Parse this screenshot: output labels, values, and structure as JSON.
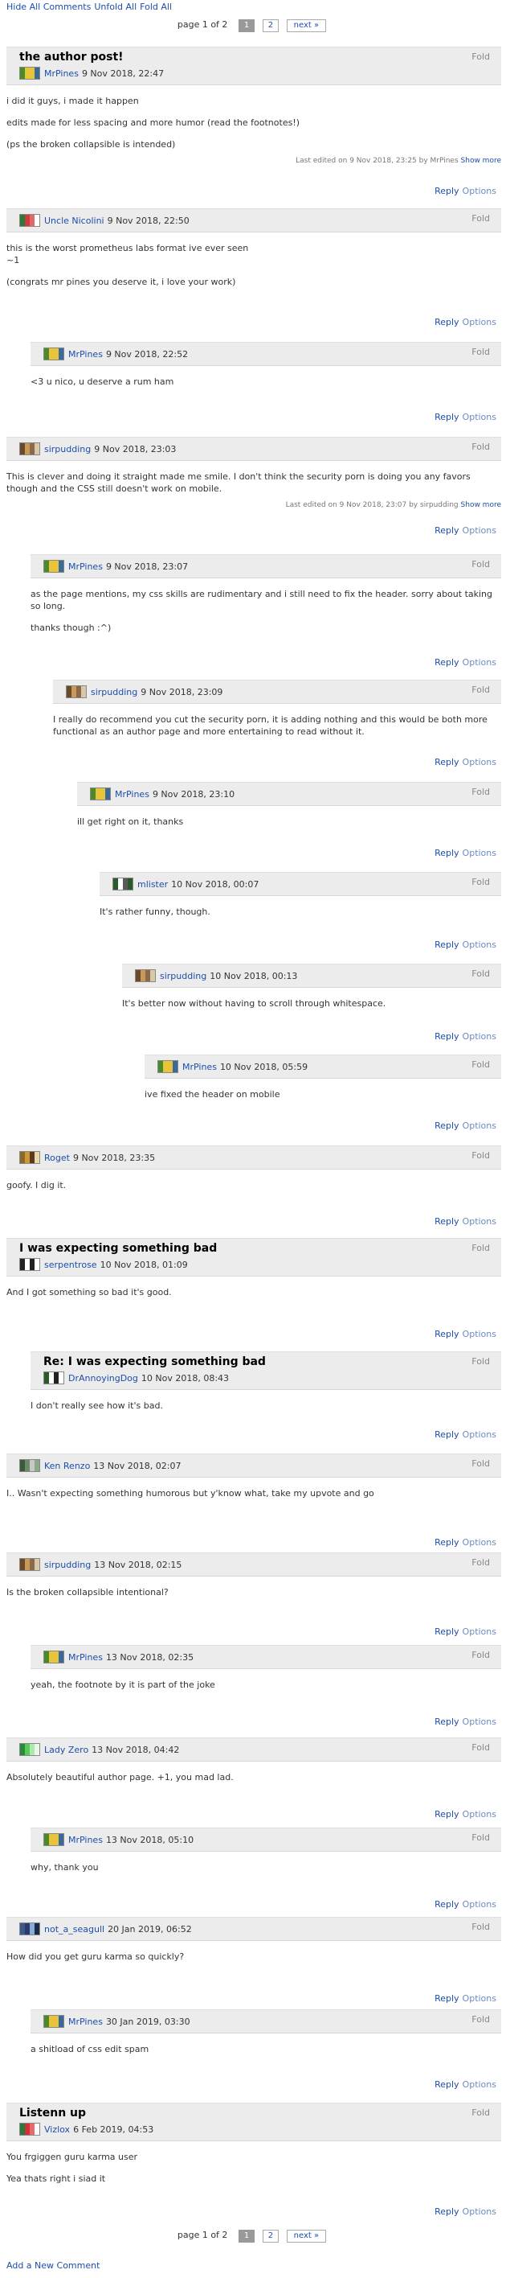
{
  "toplinks": {
    "hide_all": "Hide All Comments",
    "unfold_all": "Unfold All",
    "fold_all": "Fold All"
  },
  "pager": {
    "label": "page 1 of 2",
    "pages": [
      "1",
      "2"
    ],
    "next": "next »"
  },
  "labels": {
    "fold": "Fold",
    "reply": "Reply",
    "options": "Options",
    "show_more": "Show more"
  },
  "comments": [
    {
      "title": "the author post!",
      "user": "MrPines",
      "date": "9 Nov 2018, 22:47",
      "body": [
        "i did it guys, i made it happen",
        "edits made for less spacing and more humor (read the footnotes!)",
        "(ps the broken collapsible is intended)"
      ],
      "edited": "Last edited on 9 Nov 2018, 23:25 by MrPines"
    },
    {
      "title": "",
      "user": "Uncle Nicolini",
      "date": "9 Nov 2018, 22:50",
      "body": [
        "this is the worst prometheus labs format ive ever seen\n~1",
        "(congrats mr pines you deserve it, i love your work)"
      ],
      "edited": ""
    },
    {
      "title": "",
      "user": "MrPines",
      "date": "9 Nov 2018, 22:52",
      "body": [
        "<3 u nico, u deserve a rum ham"
      ],
      "edited": ""
    },
    {
      "title": "",
      "user": "sirpudding",
      "date": "9 Nov 2018, 23:03",
      "body": [
        "This is clever and doing it straight made me smile. I don't think the security porn is doing you any favors though and the CSS still doesn't work on mobile."
      ],
      "edited": "Last edited on 9 Nov 2018, 23:07 by sirpudding"
    },
    {
      "title": "",
      "user": "MrPines",
      "date": "9 Nov 2018, 23:07",
      "body": [
        "as the page mentions, my css skills are rudimentary and i still need to fix the header. sorry about taking so long.",
        "thanks though :^)"
      ],
      "edited": ""
    },
    {
      "title": "",
      "user": "sirpudding",
      "date": "9 Nov 2018, 23:09",
      "body": [
        "I really do recommend you cut the security porn, it is adding nothing and this would be both more functional as an author page and more entertaining to read without it."
      ],
      "edited": ""
    },
    {
      "title": "",
      "user": "MrPines",
      "date": "9 Nov 2018, 23:10",
      "body": [
        "ill get right on it, thanks"
      ],
      "edited": ""
    },
    {
      "title": "",
      "user": "mlister",
      "date": "10 Nov 2018, 00:07",
      "body": [
        "It's rather funny, though."
      ],
      "edited": ""
    },
    {
      "title": "",
      "user": "sirpudding",
      "date": "10 Nov 2018, 00:13",
      "body": [
        "It's better now without having to scroll through whitespace."
      ],
      "edited": ""
    },
    {
      "title": "",
      "user": "MrPines",
      "date": "10 Nov 2018, 05:59",
      "body": [
        "ive fixed the header on mobile"
      ],
      "edited": ""
    },
    {
      "title": "",
      "user": "Roget",
      "date": "9 Nov 2018, 23:35",
      "body": [
        "goofy. I dig it."
      ],
      "edited": ""
    },
    {
      "title": "I was expecting something bad",
      "user": "serpentrose",
      "date": "10 Nov 2018, 01:09",
      "body": [
        "And I got something so bad it's good."
      ],
      "edited": ""
    },
    {
      "title": "Re: I was expecting something bad",
      "user": "DrAnnoyingDog",
      "date": "10 Nov 2018, 08:43",
      "body": [
        "I don't really see how it's bad."
      ],
      "edited": ""
    },
    {
      "title": "",
      "user": "Ken Renzo",
      "date": "13 Nov 2018, 02:07",
      "body": [
        "I.. Wasn't expecting something humorous but y'know what, take my upvote and go"
      ],
      "edited": ""
    },
    {
      "title": "",
      "user": "sirpudding",
      "date": "13 Nov 2018, 02:15",
      "body": [
        "Is the broken collapsible intentional?"
      ],
      "edited": ""
    },
    {
      "title": "",
      "user": "MrPines",
      "date": "13 Nov 2018, 02:35",
      "body": [
        "yeah, the footnote by it is part of the joke"
      ],
      "edited": ""
    },
    {
      "title": "",
      "user": "Lady Zero",
      "date": "13 Nov 2018, 04:42",
      "body": [
        "Absolutely beautiful author page. +1, you mad lad."
      ],
      "edited": ""
    },
    {
      "title": "",
      "user": "MrPines",
      "date": "13 Nov 2018, 05:10",
      "body": [
        "why, thank you"
      ],
      "edited": ""
    },
    {
      "title": "",
      "user": "not_a_seagull",
      "date": "20 Jan 2019, 06:52",
      "body": [
        "How did you get guru karma so quickly?"
      ],
      "edited": ""
    },
    {
      "title": "",
      "user": "MrPines",
      "date": "30 Jan 2019, 03:30",
      "body": [
        "a shitload of css edit spam"
      ],
      "edited": ""
    },
    {
      "title": "Listenn up",
      "user": "Vizlox",
      "date": "6 Feb 2019, 04:53",
      "body": [
        "You frgiggen guru karma user",
        "Yea thats right i siad it"
      ],
      "edited": ""
    }
  ],
  "add_new": "Add a New Comment",
  "colors": {
    "link": "#1c4eab",
    "header_bg": "#ececec",
    "options": "#6b8bbf"
  }
}
